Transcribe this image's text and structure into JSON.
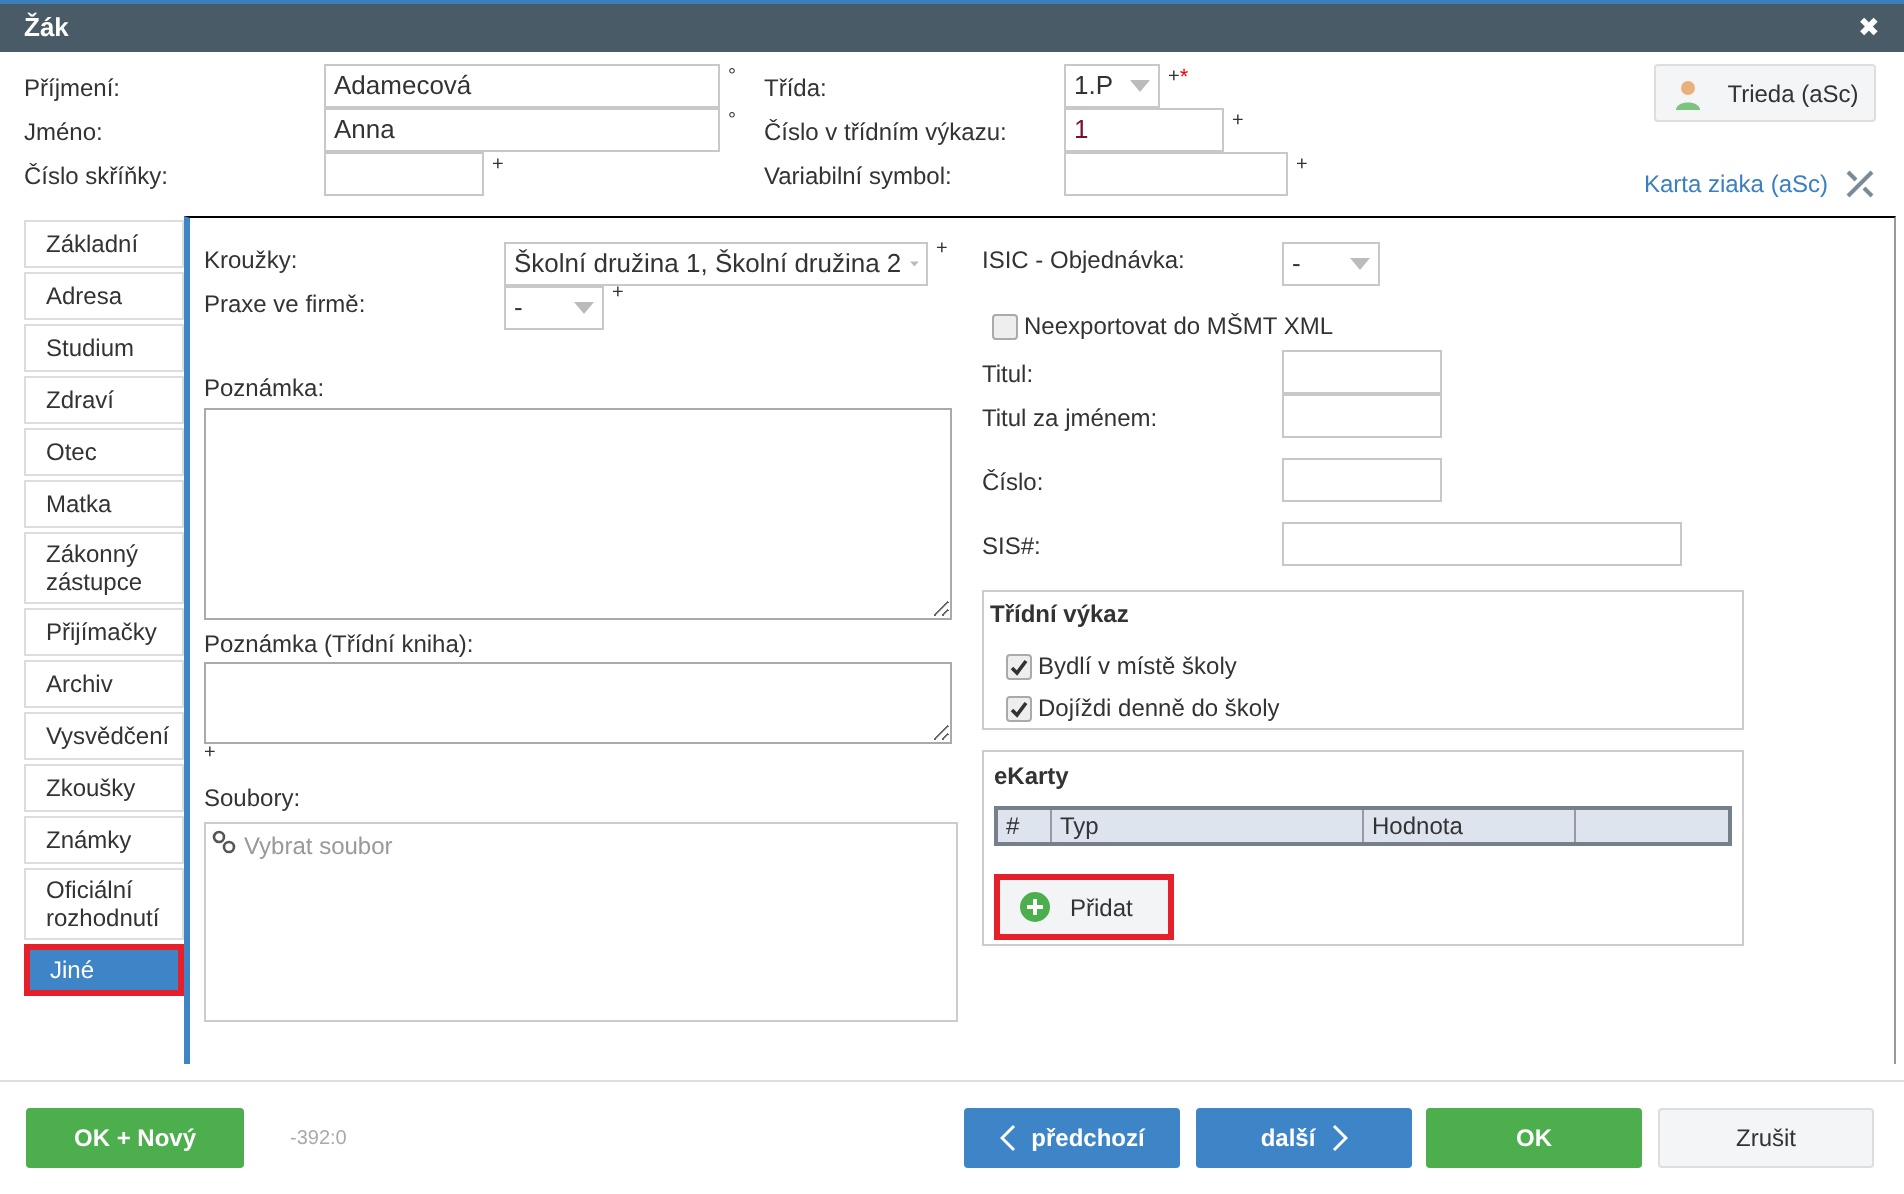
{
  "window": {
    "title": "Žák",
    "close": "✖"
  },
  "header": {
    "fields": [
      {
        "label": "Příjmení:",
        "value": "Adamecová",
        "mark": "°",
        "kind": "wide"
      },
      {
        "label": "Jméno:",
        "value": "Anna",
        "mark": "°",
        "kind": "wide"
      },
      {
        "label": "Číslo skříňky:",
        "mark": "+",
        "kind": "short"
      }
    ],
    "fields2": [
      {
        "label": "Třída:",
        "value": "1.P",
        "mark": "+",
        "required": "*",
        "kind": "select"
      },
      {
        "label": "Číslo v třídním výkazu:",
        "value": "1",
        "mark": "+",
        "kind": "short"
      },
      {
        "label": "Variabilní symbol:",
        "mark": "+",
        "kind": "medium"
      }
    ],
    "class_button": "Trieda (aSc)",
    "card_link": "Karta ziaka (aSc)"
  },
  "tabs": [
    {
      "label": "Základní",
      "selected": false,
      "highlighted": false
    },
    {
      "label": "Adresa",
      "selected": false,
      "highlighted": false
    },
    {
      "label": "Studium",
      "selected": false,
      "highlighted": false
    },
    {
      "label": "Zdraví",
      "selected": false,
      "highlighted": false
    },
    {
      "label": "Otec",
      "selected": false,
      "highlighted": false
    },
    {
      "label": "Matka",
      "selected": false,
      "highlighted": false
    },
    {
      "label": "Zákonný zástupce",
      "selected": false,
      "highlighted": false
    },
    {
      "label": "Přijímačky",
      "selected": false,
      "highlighted": false
    },
    {
      "label": "Archiv",
      "selected": false,
      "highlighted": false
    },
    {
      "label": "Vysvědčení",
      "selected": false,
      "highlighted": false
    },
    {
      "label": "Zkoušky",
      "selected": false,
      "highlighted": false
    },
    {
      "label": "Známky",
      "selected": false,
      "highlighted": false
    },
    {
      "label": "Oficiální rozhodnutí",
      "selected": false,
      "highlighted": false
    },
    {
      "label": "Jiné",
      "selected": true,
      "highlighted": true
    }
  ],
  "left": {
    "kruzky": {
      "label": "Kroužky:",
      "value": "Školní družina 1, Školní družina 2",
      "mark": "+"
    },
    "praxe": {
      "label": "Praxe ve firmě:",
      "value": "-",
      "mark": "+"
    },
    "note": {
      "label": "Poznámka:"
    },
    "note_class": {
      "label": "Poznámka (Třídní kniha):",
      "mark": "+"
    },
    "files": {
      "label": "Soubory:",
      "placeholder": "Vybrat soubor"
    }
  },
  "right": {
    "isic": {
      "label": "ISIC - Objednávka:",
      "value": "-"
    },
    "no_export": {
      "label": "Neexportovat do MŠMT XML",
      "checked": false
    },
    "fields": [
      {
        "label": "Titul:",
        "kind": "short"
      },
      {
        "label": "Titul za jménem:",
        "kind": "short"
      },
      {
        "label": "Číslo:",
        "kind": "short"
      },
      {
        "label": "SIS#:",
        "kind": "long"
      }
    ],
    "register": {
      "title": "Třídní výkaz",
      "checks": [
        {
          "label": "Bydlí v místě školy",
          "checked": true
        },
        {
          "label": "Dojíždi denně do školy",
          "checked": true
        }
      ]
    },
    "ecards": {
      "title": "eKarty",
      "columns": [
        "#",
        "Typ",
        "Hodnota"
      ],
      "add_button": "Přidat",
      "add_highlighted": true
    }
  },
  "footer": {
    "ok_new": "OK + Nový",
    "code": "-392:0",
    "prev": "předchozí",
    "next": "další",
    "ok": "OK",
    "cancel": "Zrušit"
  }
}
